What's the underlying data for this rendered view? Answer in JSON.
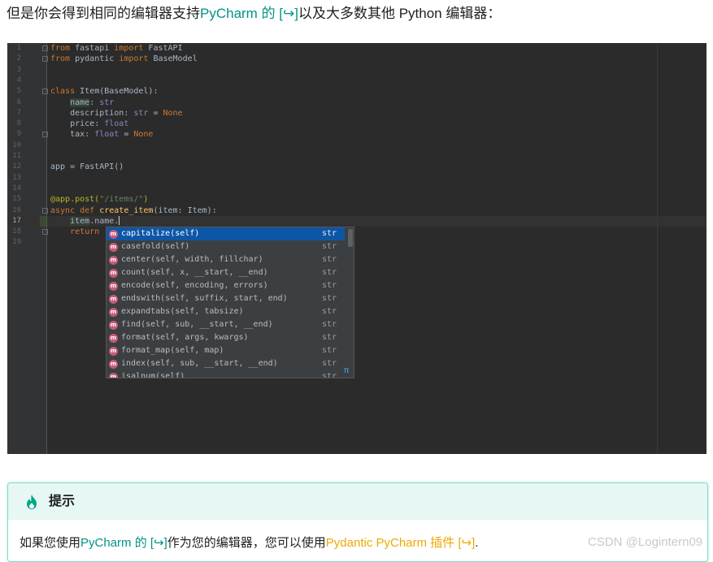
{
  "intro": {
    "before": "但是你会得到相同的编辑器支持",
    "link": "PyCharm 的 [↪]",
    "after": "以及大多数其他 Python 编辑器："
  },
  "editor": {
    "line_numbers": [
      "1",
      "2",
      "3",
      "4",
      "5",
      "6",
      "7",
      "8",
      "9",
      "10",
      "11",
      "12",
      "13",
      "14",
      "15",
      "16",
      "17",
      "18",
      "19"
    ],
    "active_line": "17",
    "code": {
      "l1": {
        "kw1": "from",
        "mod": " fastapi ",
        "kw2": "import",
        "name": " FastAPI"
      },
      "l2": {
        "kw1": "from",
        "mod": " pydantic ",
        "kw2": "import",
        "name": " BaseModel"
      },
      "l5": {
        "kw": "class",
        "rest": " Item(BaseModel):"
      },
      "l6": {
        "indent": "    ",
        "field": "name",
        "colon": ": ",
        "type": "str"
      },
      "l7": {
        "indent": "    ",
        "field": "description",
        "colon": ": ",
        "type": "str",
        "eq": " = ",
        "val": "None"
      },
      "l8": {
        "indent": "    ",
        "field": "price",
        "colon": ": ",
        "type": "float"
      },
      "l9": {
        "indent": "    ",
        "field": "tax",
        "colon": ": ",
        "type": "float",
        "eq": " = ",
        "val": "None"
      },
      "l12": {
        "text": "app = FastAPI()"
      },
      "l15": {
        "deco": "@app.post(",
        "str": "\"/items/\"",
        "close": ")"
      },
      "l16": {
        "kw": "async def",
        "sp": " ",
        "fn": "create_item",
        "rest": "(item: Item):"
      },
      "l17": {
        "indent": "    ",
        "obj": "item",
        "rest": ".name."
      },
      "l18": {
        "indent": "    ",
        "kw": "return"
      }
    }
  },
  "autocomplete": {
    "badge": "m",
    "items": [
      {
        "name": "capitalize(self)",
        "type": "str",
        "selected": true
      },
      {
        "name": "casefold(self)",
        "type": "str"
      },
      {
        "name": "center(self, width, fillchar)",
        "type": "str"
      },
      {
        "name": "count(self, x, __start, __end)",
        "type": "str"
      },
      {
        "name": "encode(self, encoding, errors)",
        "type": "str"
      },
      {
        "name": "endswith(self, suffix, start, end)",
        "type": "str"
      },
      {
        "name": "expandtabs(self, tabsize)",
        "type": "str"
      },
      {
        "name": "find(self, sub, __start, __end)",
        "type": "str"
      },
      {
        "name": "format(self, args, kwargs)",
        "type": "str"
      },
      {
        "name": "format_map(self, map)",
        "type": "str"
      },
      {
        "name": "index(self, sub, __start, __end)",
        "type": "str"
      },
      {
        "name": "isalnum(self)",
        "type": "str"
      }
    ],
    "pi_symbol": "π"
  },
  "tip": {
    "title": "提示",
    "body_before": "如果您使用",
    "link1": "PyCharm 的 [↪]",
    "body_middle": "作为您的编辑器，您可以使用",
    "link2": "Pydantic PyCharm 插件 [↪]",
    "body_after": "."
  },
  "watermark": "CSDN @Logintern09",
  "colors": {
    "link_teal": "#009485",
    "link_orange": "#f0a800",
    "editor_bg": "#2b2b2b",
    "selection": "#0d56a6"
  }
}
